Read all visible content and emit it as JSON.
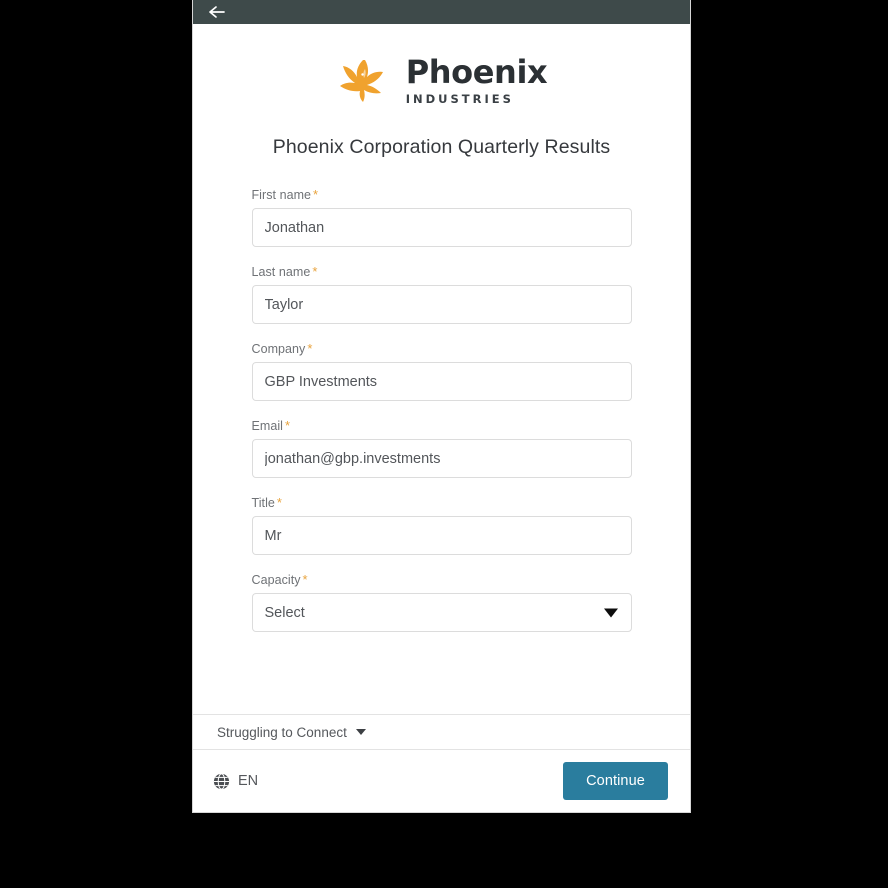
{
  "topbar": {
    "back_icon": "arrow-left-icon"
  },
  "brand": {
    "bird_icon": "phoenix-bird-icon",
    "name": "Phoenix",
    "subtitle": "INDUSTRIES",
    "accent_color": "#f0a22e",
    "text_color": "#2b3034"
  },
  "page": {
    "title": "Phoenix Corporation Quarterly Results"
  },
  "form": {
    "required_marker": "*",
    "fields": [
      {
        "label": "First name",
        "value": "Jonathan",
        "type": "text",
        "name": "first-name"
      },
      {
        "label": "Last name",
        "value": "Taylor",
        "type": "text",
        "name": "last-name"
      },
      {
        "label": "Company",
        "value": "GBP Investments",
        "type": "text",
        "name": "company"
      },
      {
        "label": "Email",
        "value": "jonathan@gbp.investments",
        "type": "text",
        "name": "email"
      },
      {
        "label": "Title",
        "value": "Mr",
        "type": "text",
        "name": "title"
      },
      {
        "label": "Capacity",
        "value": "Select",
        "type": "select",
        "name": "capacity"
      }
    ]
  },
  "footer": {
    "struggle_label": "Struggling to Connect",
    "struggle_caret_icon": "chevron-down-icon",
    "globe_icon": "globe-icon",
    "language": "EN",
    "continue_label": "Continue",
    "continue_color": "#2a7d9e"
  }
}
